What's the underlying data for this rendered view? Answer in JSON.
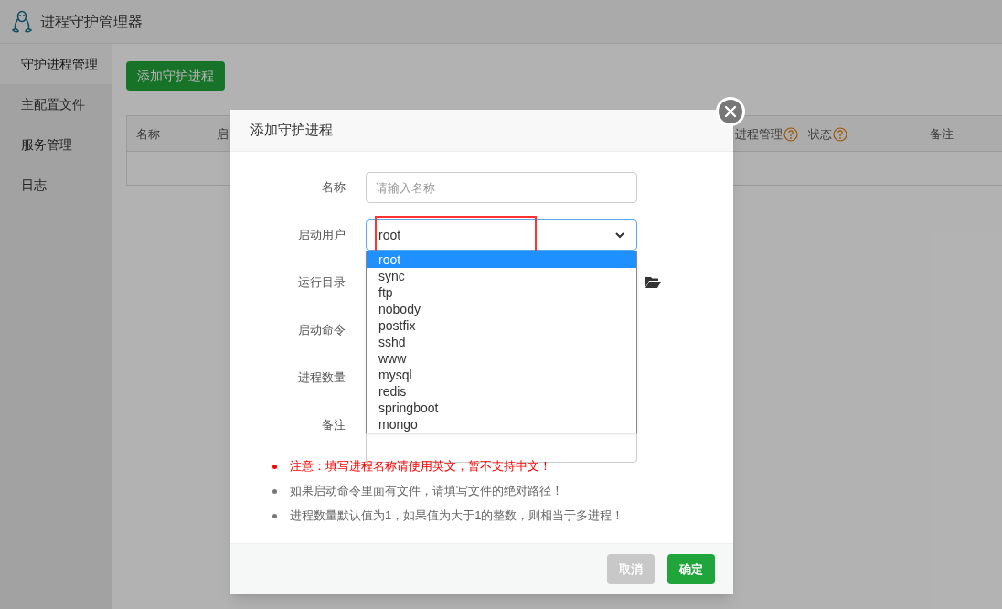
{
  "app": {
    "title": "进程守护管理器"
  },
  "sidebar": {
    "items": [
      {
        "label": "守护进程管理",
        "selected": true
      },
      {
        "label": "主配置文件",
        "selected": false
      },
      {
        "label": "服务管理",
        "selected": false
      },
      {
        "label": "日志",
        "selected": false
      }
    ]
  },
  "toolbar": {
    "add_button": "添加守护进程"
  },
  "table": {
    "columns": [
      {
        "label": "名称",
        "help": false
      },
      {
        "label": "启",
        "help": false
      },
      {
        "label": "进程管理",
        "help": true
      },
      {
        "label": "状态",
        "help": true
      },
      {
        "label": "备注",
        "help": false
      }
    ]
  },
  "dialog": {
    "title": "添加守护进程",
    "fields": [
      {
        "label": "名称",
        "kind": "text",
        "placeholder": "请输入名称"
      },
      {
        "label": "启动用户",
        "kind": "select",
        "value": "root",
        "expanded": true,
        "options": [
          {
            "label": "root",
            "selected": true
          },
          {
            "label": "sync",
            "selected": false
          },
          {
            "label": "ftp",
            "selected": false
          },
          {
            "label": "nobody",
            "selected": false
          },
          {
            "label": "postfix",
            "selected": false
          },
          {
            "label": "sshd",
            "selected": false
          },
          {
            "label": "www",
            "selected": false
          },
          {
            "label": "mysql",
            "selected": false
          },
          {
            "label": "redis",
            "selected": false
          },
          {
            "label": "springboot",
            "selected": false
          },
          {
            "label": "mongo",
            "selected": false
          }
        ]
      },
      {
        "label": "运行目录",
        "kind": "directory"
      },
      {
        "label": "启动命令",
        "kind": "hidden"
      },
      {
        "label": "进程数量",
        "kind": "hidden"
      },
      {
        "label": "备注",
        "kind": "textarea"
      }
    ],
    "notes": [
      {
        "text": "注意：填写进程名称请使用英文，暂不支持中文！",
        "kind": "warning"
      },
      {
        "text": "如果启动命令里面有文件，请填写文件的绝对路径！",
        "kind": "info"
      },
      {
        "text": "进程数量默认值为1，如果值为大于1的整数，则相当于多进程！",
        "kind": "info"
      }
    ],
    "buttons": [
      {
        "label": "取消",
        "kind": "cancel"
      },
      {
        "label": "确定",
        "kind": "confirm"
      }
    ]
  }
}
